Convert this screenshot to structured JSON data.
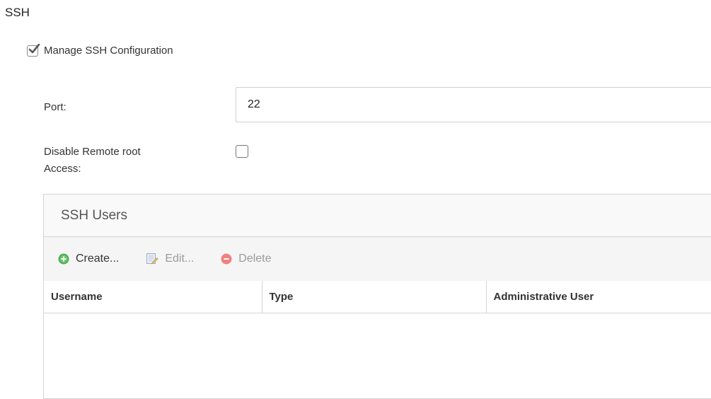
{
  "section": {
    "title": "SSH"
  },
  "manage": {
    "label": "Manage SSH Configuration",
    "checked": true
  },
  "port": {
    "label": "Port:",
    "value": "22"
  },
  "disable_root": {
    "label_line1": "Disable Remote root",
    "label_line2": "Access:",
    "checked": false
  },
  "ssh_users": {
    "title": "SSH Users",
    "toolbar": {
      "create_label": "Create...",
      "edit_label": "Edit...",
      "delete_label": "Delete"
    },
    "columns": [
      "Username",
      "Type",
      "Administrative User"
    ],
    "rows": []
  },
  "colors": {
    "create_icon": "#4caf50",
    "delete_icon": "#f08080",
    "checkbox_border": "#777777"
  }
}
